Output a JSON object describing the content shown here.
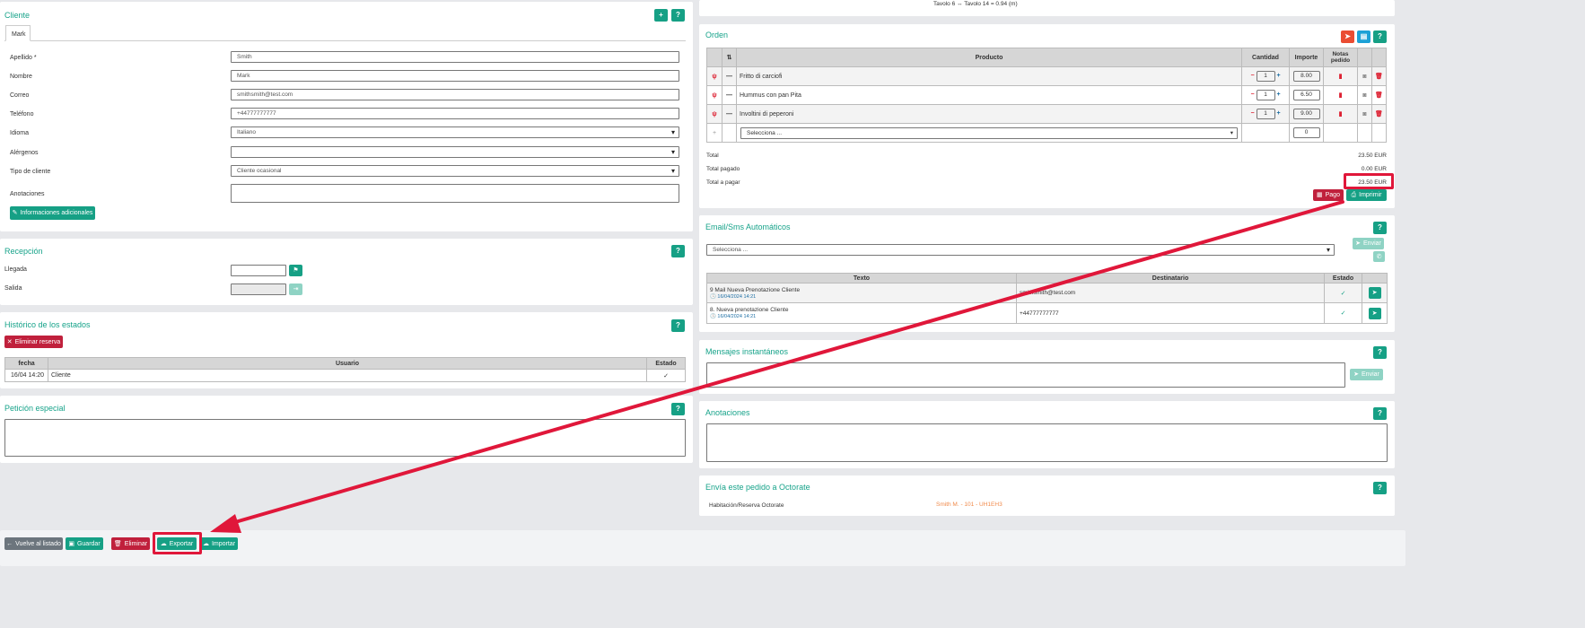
{
  "cliente": {
    "title": "Cliente",
    "tab": "Mark",
    "help": "?",
    "add": "+",
    "labels": {
      "apellido": "Apellido *",
      "nombre": "Nombre",
      "correo": "Correo",
      "telefono": "Teléfono",
      "idioma": "Idioma",
      "alergenos": "Alérgenos",
      "tipo": "Tipo de cliente",
      "anotaciones": "Anotaciones"
    },
    "values": {
      "apellido": "Smith",
      "nombre": "Mark",
      "correo": "smithsmith@test.com",
      "telefono": "+44777777777",
      "idioma": "Italiano",
      "alergenos": "",
      "tipo": "Cliente ocasional",
      "anotaciones": ""
    },
    "info_button": "Informaciones adicionales"
  },
  "recepcion": {
    "title": "Recepción",
    "llegada": "Llegada",
    "salida": "Salida"
  },
  "historico": {
    "title": "Histórico de los estados",
    "delete_button": "Eliminar reserva",
    "headers": [
      "fecha",
      "Usuario",
      "Estado"
    ],
    "rows": [
      {
        "fecha": "16/04 14:20",
        "usuario": "Cliente",
        "estado": "✓"
      }
    ]
  },
  "peticion": {
    "title": "Petición especial"
  },
  "bottom": {
    "volver": "Vuelve al listado",
    "guardar": "Guardar",
    "eliminar": "Eliminar",
    "exportar": "Exportar",
    "importar": "Importar"
  },
  "mesa": {
    "text": "Tavolo 6 ↔ Tavolo 14 = 0.94 (m)"
  },
  "orden": {
    "title": "Orden",
    "headers": {
      "sort": "⇅",
      "producto": "Producto",
      "cantidad": "Cantidad",
      "importe": "Importe",
      "notas": "Notas pedido"
    },
    "items": [
      {
        "name": "Fritto di carciofi",
        "qty": "1",
        "price": "8.00"
      },
      {
        "name": "Hummus con pan Pita",
        "qty": "1",
        "price": "6.50"
      },
      {
        "name": "Involtini di peperoni",
        "qty": "1",
        "price": "9.00"
      }
    ],
    "new_placeholder": "Selecciona ...",
    "new_qty": "0",
    "total_label": "Total",
    "total": "23.50 EUR",
    "pagado_label": "Total pagado",
    "pagado": "0.00 EUR",
    "pagar_label": "Total a pagar",
    "pagar": "23.50 EUR",
    "pago": "Pago",
    "imprimir": "Imprimir"
  },
  "email": {
    "title": "Email/Sms Automáticos",
    "select": "Selecciona ...",
    "enviar": "Enviar",
    "headers": [
      "Texto",
      "Destinatario",
      "Estado"
    ],
    "rows": [
      {
        "texto": "9 Mail Nueva Prenotazione Cliente",
        "fecha": "16/04/2024 14:21",
        "dest": "smithsmith@test.com"
      },
      {
        "texto": "8. Nueva prenotazione Cliente",
        "fecha": "16/04/2024 14:21",
        "dest": "+44777777777"
      }
    ]
  },
  "mensajes": {
    "title": "Mensajes instantáneos",
    "enviar": "Enviar"
  },
  "anotaciones": {
    "title": "Anotaciones"
  },
  "octorate": {
    "title": "Envía este pedido a Octorate",
    "label": "Habitación/Reserva Octorate",
    "value": "Smith M. - 101 - UH1EH3"
  }
}
